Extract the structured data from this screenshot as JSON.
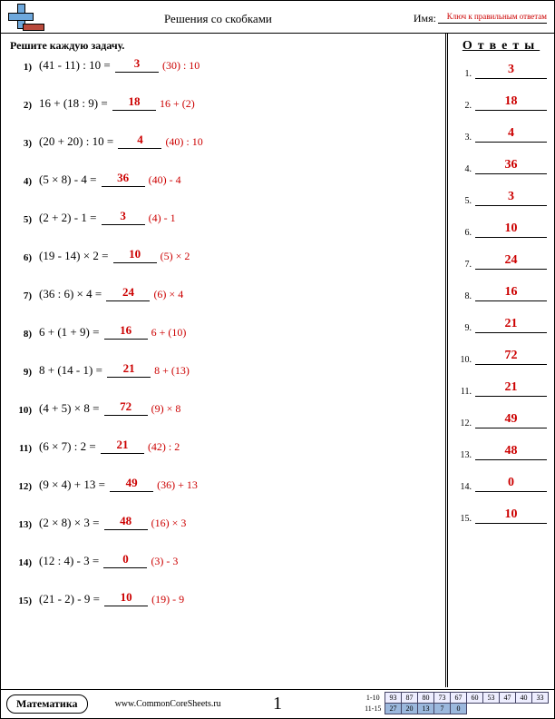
{
  "header": {
    "title": "Решения со скобками",
    "name_label": "Имя:",
    "key_note": "Ключ к правильным ответам"
  },
  "instruction": "Решите каждую задачу.",
  "answers_title": "Ответы",
  "problems": [
    {
      "n": "1)",
      "expr": "(41 - 11) : 10 =",
      "ans": "3",
      "hint": "(30) : 10"
    },
    {
      "n": "2)",
      "expr": "16 + (18 : 9) =",
      "ans": "18",
      "hint": "16 + (2)"
    },
    {
      "n": "3)",
      "expr": "(20 + 20) : 10 =",
      "ans": "4",
      "hint": "(40) : 10"
    },
    {
      "n": "4)",
      "expr": "(5 × 8) - 4 =",
      "ans": "36",
      "hint": "(40) - 4"
    },
    {
      "n": "5)",
      "expr": "(2 + 2) - 1 =",
      "ans": "3",
      "hint": "(4) - 1"
    },
    {
      "n": "6)",
      "expr": "(19 - 14) × 2 =",
      "ans": "10",
      "hint": "(5) × 2"
    },
    {
      "n": "7)",
      "expr": "(36 : 6) × 4 =",
      "ans": "24",
      "hint": "(6) × 4"
    },
    {
      "n": "8)",
      "expr": "6 + (1 + 9) =",
      "ans": "16",
      "hint": "6 + (10)"
    },
    {
      "n": "9)",
      "expr": "8 + (14 - 1) =",
      "ans": "21",
      "hint": "8 + (13)"
    },
    {
      "n": "10)",
      "expr": "(4 + 5) × 8 =",
      "ans": "72",
      "hint": "(9) × 8"
    },
    {
      "n": "11)",
      "expr": "(6 × 7) : 2 =",
      "ans": "21",
      "hint": "(42) : 2"
    },
    {
      "n": "12)",
      "expr": "(9 × 4) + 13 =",
      "ans": "49",
      "hint": "(36) + 13"
    },
    {
      "n": "13)",
      "expr": "(2 × 8) × 3 =",
      "ans": "48",
      "hint": "(16) × 3"
    },
    {
      "n": "14)",
      "expr": "(12 : 4) - 3 =",
      "ans": "0",
      "hint": "(3) - 3"
    },
    {
      "n": "15)",
      "expr": "(21 - 2) - 9 =",
      "ans": "10",
      "hint": "(19) - 9"
    }
  ],
  "answers": [
    "3",
    "18",
    "4",
    "36",
    "3",
    "10",
    "24",
    "16",
    "21",
    "72",
    "21",
    "49",
    "48",
    "0",
    "10"
  ],
  "footer": {
    "subject": "Математика",
    "site": "www.CommonCoreSheets.ru",
    "page": "1",
    "score_row1_label": "1-10",
    "score_row2_label": "11-15",
    "row1": [
      "93",
      "87",
      "80",
      "73",
      "67",
      "60",
      "53",
      "47",
      "40",
      "33"
    ],
    "row2": [
      "27",
      "20",
      "13",
      "7",
      "0"
    ]
  }
}
